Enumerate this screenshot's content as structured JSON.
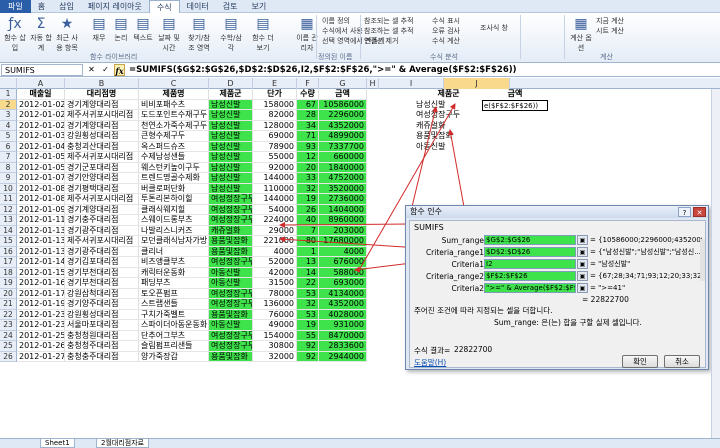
{
  "ribbon": {
    "tabs": [
      "파일",
      "홈",
      "삽입",
      "페이지 레이아웃",
      "수식",
      "데이터",
      "검토",
      "보기"
    ],
    "active_tab_index": 4,
    "buttons": [
      {
        "label": "함수\n삽입",
        "icon": "fx-icon"
      },
      {
        "label": "자동\n합계",
        "icon": "sigma-icon"
      },
      {
        "label": "최근\n사용 항목",
        "icon": "star-icon"
      },
      {
        "label": "재무",
        "icon": "book-icon"
      },
      {
        "label": "논리",
        "icon": "book-icon"
      },
      {
        "label": "텍스트",
        "icon": "book-icon"
      },
      {
        "label": "날짜 및\n시간",
        "icon": "book-icon"
      },
      {
        "label": "찾기/참조\n영역",
        "icon": "book-icon"
      },
      {
        "label": "수학/삼각",
        "icon": "book-icon"
      },
      {
        "label": "함수\n더 보기",
        "icon": "book-icon"
      },
      {
        "label": "이름\n관리자",
        "icon": "tag-icon"
      }
    ],
    "small_items": [
      "이름 정의",
      "수식에서 사용",
      "선택 영역에서 만들기",
      "참조되는 셀 추적",
      "참조하는 셀 추적",
      "연결선 제거",
      "수식 표시",
      "오류 검사",
      "수식 계산",
      "조사식 창",
      "지금 계산",
      "시트 계산"
    ],
    "groups": [
      "함수 라이브러리",
      "정의된 이름",
      "수식 분석",
      "계산"
    ],
    "calc_label": "계산\n옵션"
  },
  "formula_bar": {
    "name_box": "SUMIFS",
    "cancel": "✕",
    "enter": "✓",
    "fx": "fx",
    "formula": "=SUMIFS($G$2:$G$26,$D$2:$D$26,I2,$F$2:$F$26,\">=\" & Average($F$2:$F$26))"
  },
  "columns": [
    "A",
    "B",
    "C",
    "D",
    "E",
    "F",
    "G",
    "H",
    "I",
    "J"
  ],
  "headers": [
    "매출일",
    "대리점명",
    "제품명",
    "제품군",
    "단가",
    "수량",
    "금액"
  ],
  "rows": [
    [
      "2012-01-02",
      "경기계양대리점",
      "비비포패수츠",
      "남성신발",
      "158000",
      "67",
      "10586000"
    ],
    [
      "2012-01-02",
      "제주서귀포시대리점",
      "도드포인트수재구두",
      "남성신발",
      "82000",
      "28",
      "2296000"
    ],
    [
      "2012-01-02",
      "경기계양대리점",
      "천연소가죽수제구두",
      "남성신발",
      "128000",
      "34",
      "4352000"
    ],
    [
      "2012-01-03",
      "강원횡성대리점",
      "큰형수제구두",
      "남성신발",
      "69000",
      "71",
      "4899000"
    ],
    [
      "2012-01-04",
      "충청괴산대리점",
      "옥스퍼드슈즈",
      "남성신발",
      "78900",
      "93",
      "7337700"
    ],
    [
      "2012-01-05",
      "제주서귀포시대리점",
      "수제남성샌들",
      "남성신발",
      "55000",
      "12",
      "660000"
    ],
    [
      "2012-01-05",
      "경기군포대리점",
      "웨스턴키높이구두",
      "남성신발",
      "92000",
      "20",
      "1840000"
    ],
    [
      "2012-01-07",
      "경기안양대리점",
      "트렌드명골수제화",
      "남성신발",
      "144000",
      "33",
      "4752000"
    ],
    [
      "2012-01-08",
      "경기평택대리점",
      "버클로퍼단화",
      "남성신발",
      "110000",
      "32",
      "3520000"
    ],
    [
      "2012-01-08",
      "제주서귀포시대리점",
      "투톤리본하이힐",
      "여성정장구두",
      "144000",
      "19",
      "2736000"
    ],
    [
      "2012-01-09",
      "경기계양대리점",
      "클래식웨지힐",
      "여성정장구두",
      "54000",
      "26",
      "1404000"
    ],
    [
      "2012-01-11",
      "경기충주대리점",
      "스웨이드롱부츠",
      "여성정장구두",
      "224000",
      "40",
      "8960000"
    ],
    [
      "2012-01-13",
      "경기광주대리점",
      "나발리스니커즈",
      "캐쥬얼화",
      "29000",
      "7",
      "203000"
    ],
    [
      "2012-01-13",
      "제주서귀포시대리점",
      "모던클래식남자가방",
      "용품및잡화",
      "221000",
      "80",
      "17680000"
    ],
    [
      "2012-01-13",
      "경기광주대리점",
      "클리너",
      "용품및잡화",
      "4000",
      "1",
      "4000"
    ],
    [
      "2012-01-14",
      "경기김포대리점",
      "비즈앵클부츠",
      "여성정장구두",
      "52000",
      "13",
      "676000"
    ],
    [
      "2012-01-15",
      "경기부천대리점",
      "캐릭터운동화",
      "아동신발",
      "42000",
      "14",
      "588000"
    ],
    [
      "2012-01-16",
      "경기부천대리점",
      "패딩부츠",
      "아동신발",
      "31500",
      "22",
      "693000"
    ],
    [
      "2012-01-17",
      "강원삼척대리점",
      "토오픈펌프",
      "여성정장구두",
      "78000",
      "53",
      "4134000"
    ],
    [
      "2012-01-19",
      "경기양주대리점",
      "스트랩샌들",
      "여성정장구두",
      "136000",
      "32",
      "4352000"
    ],
    [
      "2012-01-23",
      "강원횡성대리점",
      "구치가죽벨트",
      "용품및잡화",
      "76000",
      "53",
      "4028000"
    ],
    [
      "2012-01-23",
      "서울마포대리점",
      "스파이더아동운동화",
      "아동신발",
      "49000",
      "19",
      "931000"
    ],
    [
      "2012-01-25",
      "충청청원대리점",
      "단추어그부츠",
      "여성정장구두",
      "154000",
      "55",
      "8470000"
    ],
    [
      "2012-01-26",
      "충청청주대리점",
      "슬림펌프리샌들",
      "여성정장구두",
      "30800",
      "92",
      "2833600"
    ],
    [
      "2012-01-27",
      "충청충주대리점",
      "양가죽장갑",
      "용품및잡화",
      "32000",
      "92",
      "2944000"
    ]
  ],
  "category_list": {
    "header": "제품군",
    "items": [
      "남성신발",
      "여성정장구두",
      "캐쥬얼화",
      "용품및잡화",
      "아동신발"
    ]
  },
  "amount_header": "금액",
  "j2_value": "e($F$2:$F$26))",
  "dialog": {
    "title": "함수 인수",
    "function_name": "SUMIFS",
    "args": [
      {
        "label": "Sum_range",
        "value": "$G$2:$G$26",
        "result": "= {10586000;2296000;4352000;489..."
      },
      {
        "label": "Criteria_range1",
        "value": "$D$2:$D$26",
        "result": "= {\"남성신발\";\"남성신발\";\"남성신..."
      },
      {
        "label": "Criteria1",
        "value": "I2",
        "result": "= \"남성신발\""
      },
      {
        "label": "Criteria_range2",
        "value": "$F$2:$F$26",
        "result": "= {67;28;34;71;93;12;20;33;32;19..."
      },
      {
        "label": "Criteria2",
        "value": "\">=\" & Average($F$2:$F$26)",
        "result": "= \">=41\""
      }
    ],
    "total": "= 22822700",
    "description": "주어진 조건에 따라 지정되는 셀을 더합니다.",
    "arg_help": "Sum_range: 은(는) 합을 구할 실제 셀입니다.",
    "result_label": "수식 결과=",
    "result_value": "22822700",
    "help_link": "도움말(H)",
    "ok": "확인",
    "cancel": "취소"
  },
  "sheet_tabs": [
    "Sheet1",
    "2월대리점자료"
  ],
  "colors": {
    "highlight": "#3ee24a",
    "arrow": "#d22b2b"
  }
}
